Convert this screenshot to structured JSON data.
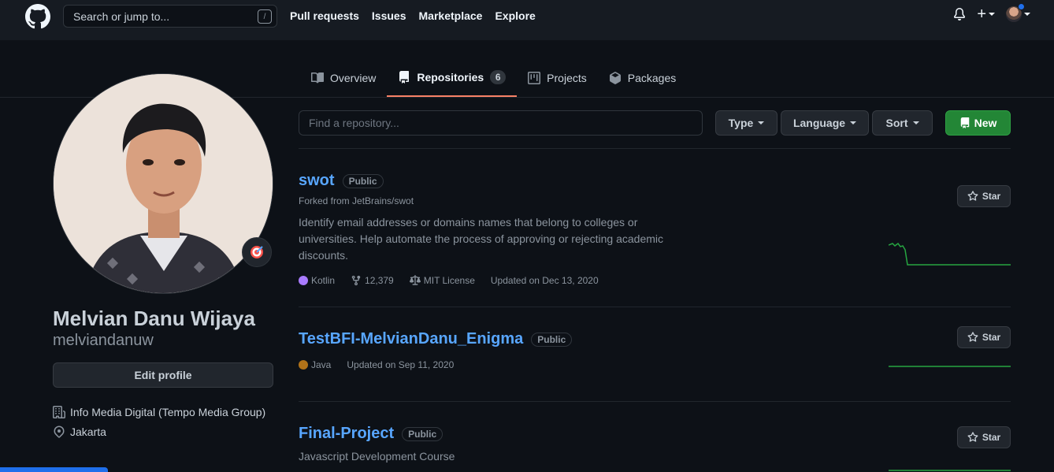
{
  "header": {
    "search_placeholder": "Search or jump to...",
    "search_shortcut": "/",
    "nav": [
      "Pull requests",
      "Issues",
      "Marketplace",
      "Explore"
    ],
    "plus_label": "+"
  },
  "tabs": [
    {
      "label": "Overview"
    },
    {
      "label": "Repositories",
      "count": "6"
    },
    {
      "label": "Projects"
    },
    {
      "label": "Packages"
    }
  ],
  "profile": {
    "full_name": "Melvian Danu Wijaya",
    "username": "melviandanuw",
    "edit_label": "Edit profile",
    "company": "Info Media Digital (Tempo Media Group)",
    "location": "Jakarta"
  },
  "filters": {
    "find_placeholder": "Find a repository...",
    "type_label": "Type",
    "language_label": "Language",
    "sort_label": "Sort",
    "new_label": "New"
  },
  "repos": [
    {
      "name": "swot",
      "visibility": "Public",
      "forked_from": "Forked from JetBrains/swot",
      "description": "Identify email addresses or domains names that belong to colleges or universities. Help automate the process of approving or rejecting academic discounts.",
      "language": "Kotlin",
      "language_color": "#a97bff",
      "forks": "12,379",
      "license": "MIT License",
      "updated": "Updated on Dec 13, 2020",
      "star_label": "Star"
    },
    {
      "name": "TestBFI-MelvianDanu_Enigma",
      "visibility": "Public",
      "language": "Java",
      "language_color": "#b07219",
      "updated": "Updated on Sep 11, 2020",
      "star_label": "Star"
    },
    {
      "name": "Final-Project",
      "visibility": "Public",
      "description": "Javascript Development Course",
      "star_label": "Star"
    }
  ],
  "colors": {
    "background": "#0d1117",
    "link": "#58a6ff",
    "new_button": "#238636",
    "active_tab_underline": "#f78166"
  }
}
